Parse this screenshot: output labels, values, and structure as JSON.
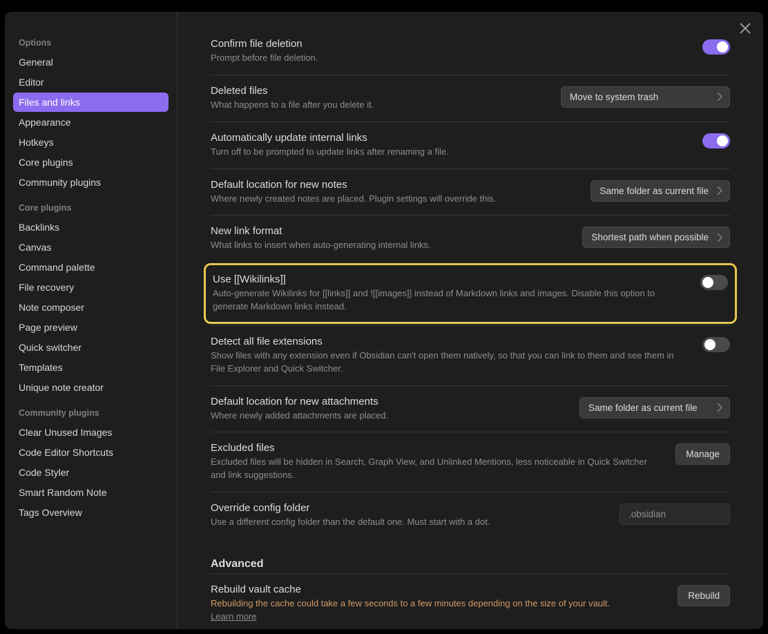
{
  "sidebar": {
    "sections": [
      {
        "header": "Options",
        "items": [
          "General",
          "Editor",
          "Files and links",
          "Appearance",
          "Hotkeys",
          "Core plugins",
          "Community plugins"
        ]
      },
      {
        "header": "Core plugins",
        "items": [
          "Backlinks",
          "Canvas",
          "Command palette",
          "File recovery",
          "Note composer",
          "Page preview",
          "Quick switcher",
          "Templates",
          "Unique note creator"
        ]
      },
      {
        "header": "Community plugins",
        "items": [
          "Clear Unused Images",
          "Code Editor Shortcuts",
          "Code Styler",
          "Smart Random Note",
          "Tags Overview"
        ]
      }
    ],
    "active": "Files and links"
  },
  "settings": {
    "confirm_delete": {
      "title": "Confirm file deletion",
      "desc": "Prompt before file deletion.",
      "value": true
    },
    "deleted_files": {
      "title": "Deleted files",
      "desc": "What happens to a file after you delete it.",
      "value": "Move to system trash"
    },
    "auto_update_links": {
      "title": "Automatically update internal links",
      "desc": "Turn off to be prompted to update links after renaming a file.",
      "value": true
    },
    "default_note_location": {
      "title": "Default location for new notes",
      "desc": "Where newly created notes are placed. Plugin settings will override this.",
      "value": "Same folder as current file"
    },
    "new_link_format": {
      "title": "New link format",
      "desc": "What links to insert when auto-generating internal links.",
      "value": "Shortest path when possible"
    },
    "wikilinks": {
      "title": "Use [[Wikilinks]]",
      "desc": "Auto-generate Wikilinks for [[links]] and ![[images]] instead of Markdown links and images. Disable this option to generate Markdown links instead.",
      "value": false
    },
    "detect_extensions": {
      "title": "Detect all file extensions",
      "desc": "Show files with any extension even if Obsidian can't open them natively, so that you can link to them and see them in File Explorer and Quick Switcher.",
      "value": false
    },
    "default_attachment_location": {
      "title": "Default location for new attachments",
      "desc": "Where newly added attachments are placed.",
      "value": "Same folder as current file"
    },
    "excluded_files": {
      "title": "Excluded files",
      "desc": "Excluded files will be hidden in Search, Graph View, and Unlinked Mentions, less noticeable in Quick Switcher and link suggestions.",
      "button": "Manage"
    },
    "override_config": {
      "title": "Override config folder",
      "desc": "Use a different config folder than the default one. Must start with a dot.",
      "placeholder": ".obsidian"
    },
    "advanced_heading": "Advanced",
    "rebuild_cache": {
      "title": "Rebuild vault cache",
      "desc": "Rebuilding the cache could take a few seconds to a few minutes depending on the size of your vault.",
      "link": "Learn more",
      "button": "Rebuild"
    }
  }
}
